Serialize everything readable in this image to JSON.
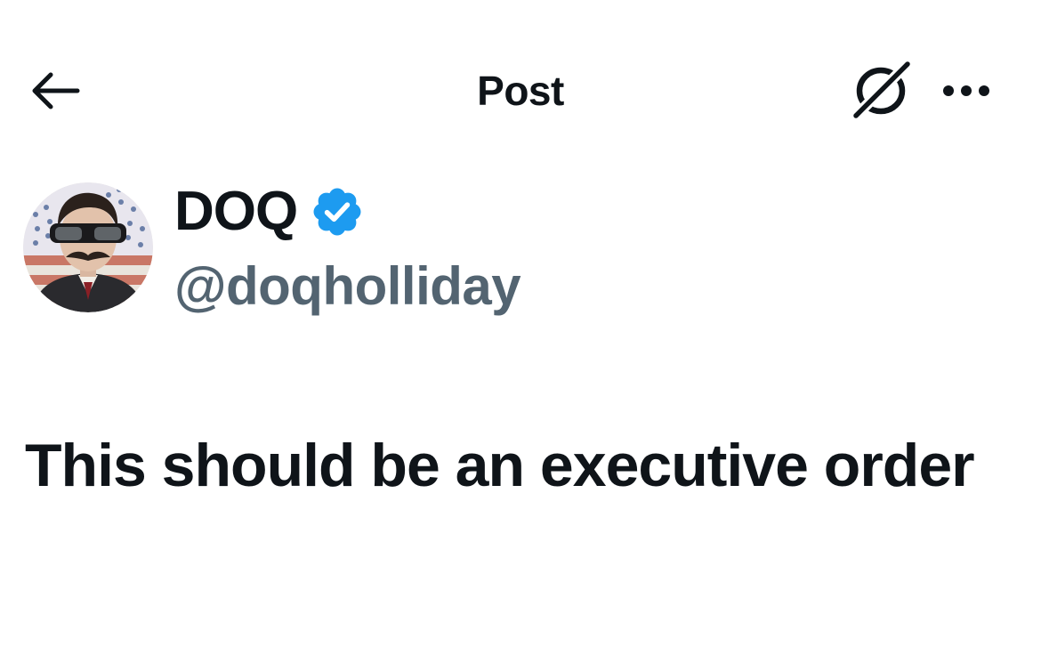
{
  "header": {
    "title": "Post",
    "back_icon": "arrow-left-icon",
    "grok_icon": "grok-icon",
    "more_icon": "more-horizontal-icon"
  },
  "author": {
    "display_name": "DOQ",
    "handle": "@doqholliday",
    "verified": true,
    "verified_color": "#1d9bf0"
  },
  "post": {
    "text": "This should be an executive order"
  },
  "colors": {
    "text_primary": "#0f1419",
    "text_secondary": "#536471",
    "background": "#ffffff",
    "accent": "#1d9bf0"
  }
}
